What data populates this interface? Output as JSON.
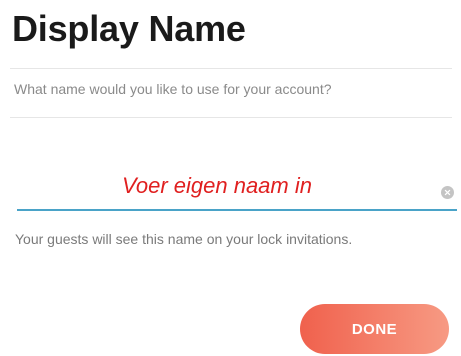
{
  "header": {
    "title": "Display Name",
    "subtitle": "What name would you like to use for your account?"
  },
  "name_field": {
    "value": "",
    "placeholder": "Voer eigen naam in",
    "clear_icon": "clear-icon"
  },
  "helper_text": "Your guests will see this name on your lock invitations.",
  "actions": {
    "done_label": "DONE"
  },
  "colors": {
    "accent_underline": "#4aa3c8",
    "button_gradient_start": "#f0614d",
    "button_gradient_end": "#f79a83",
    "placeholder_text": "#e02020"
  }
}
